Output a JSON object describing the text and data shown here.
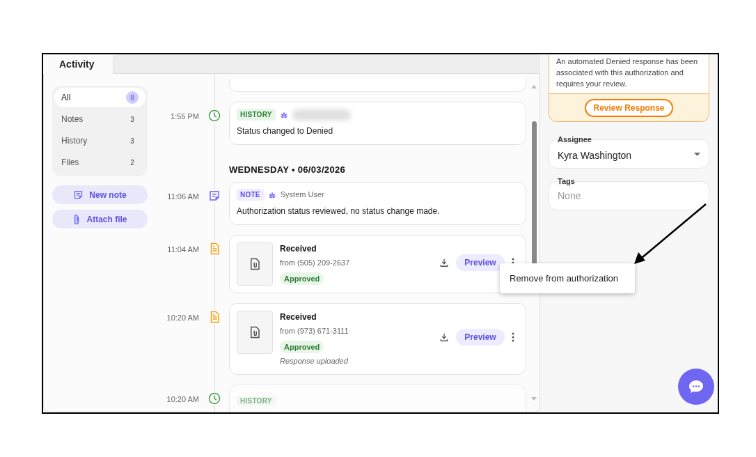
{
  "tabs": [
    {
      "label": "Activity",
      "selected": true
    }
  ],
  "filters": [
    {
      "label": "All",
      "count": "8",
      "selected": true
    },
    {
      "label": "Notes",
      "count": "3",
      "selected": false
    },
    {
      "label": "History",
      "count": "3",
      "selected": false
    },
    {
      "label": "Files",
      "count": "2",
      "selected": false
    }
  ],
  "actions": [
    {
      "label": "New note",
      "kind": "note"
    },
    {
      "label": "Attach file",
      "kind": "attach"
    }
  ],
  "timeline": [
    {
      "kind": "partial"
    },
    {
      "kind": "history",
      "time": "1:55 PM",
      "tag": "HISTORY",
      "text": "Status changed to Denied"
    },
    {
      "kind": "date",
      "label": "WEDNESDAY • 06/03/2026"
    },
    {
      "kind": "note",
      "time": "11:06 AM",
      "tag": "NOTE",
      "author": "System User",
      "text": "Authorization status reviewed, no status change made."
    },
    {
      "kind": "file",
      "time": "11:04 AM",
      "title": "Received",
      "from": "from (505) 209-2637",
      "status": "Approved",
      "button": "Preview"
    },
    {
      "kind": "file",
      "time": "10:20 AM",
      "title": "Received",
      "from": "from (973) 671-3111",
      "status": "Approved",
      "button": "Preview",
      "note": "Response uploaded"
    },
    {
      "kind": "history_cut",
      "time": "10:20 AM",
      "tag": "HISTORY"
    }
  ],
  "context_menu": {
    "items": [
      "Remove from authorization"
    ]
  },
  "alert": {
    "text": "An automated Denied response has been associated with this authorization and requires your review.",
    "button": "Review Response"
  },
  "assignee": {
    "label": "Assignee",
    "value": "Kyra Washington"
  },
  "tags": {
    "label": "Tags",
    "placeholder": "None"
  }
}
